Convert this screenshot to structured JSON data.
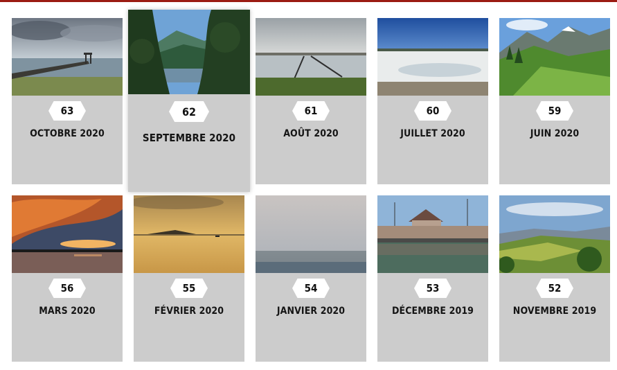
{
  "issues": [
    {
      "number": "63",
      "title": "OCTOBRE 2020",
      "image_icon": "pier-lake-icon"
    },
    {
      "number": "62",
      "title": "SEPTEMBRE 2020",
      "image_icon": "mountain-lake-forest-icon"
    },
    {
      "number": "61",
      "title": "AOÛT 2020",
      "image_icon": "salt-marsh-icon"
    },
    {
      "number": "60",
      "title": "JUILLET 2020",
      "image_icon": "salt-flat-icon"
    },
    {
      "number": "59",
      "title": "JUIN 2020",
      "image_icon": "alpine-meadow-icon"
    },
    {
      "number": "56",
      "title": "MARS 2020",
      "image_icon": "sunset-sea-icon"
    },
    {
      "number": "55",
      "title": "FÉVRIER 2020",
      "image_icon": "golden-lake-icon"
    },
    {
      "number": "54",
      "title": "JANVIER 2020",
      "image_icon": "fog-town-icon"
    },
    {
      "number": "53",
      "title": "DÉCEMBRE 2019",
      "image_icon": "canal-building-icon"
    },
    {
      "number": "52",
      "title": "NOVEMBRE 2019",
      "image_icon": "vineyard-hills-icon"
    }
  ],
  "colors": {
    "accent": "#9b1b12",
    "card_bg": "#cccccc",
    "badge_bg": "#ffffff"
  }
}
